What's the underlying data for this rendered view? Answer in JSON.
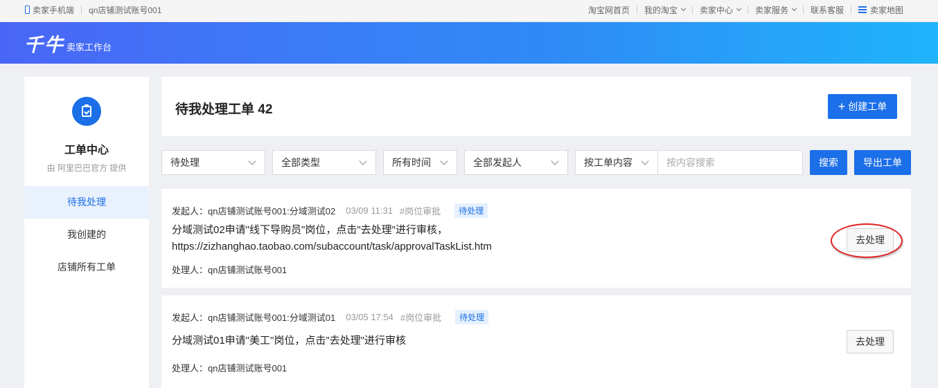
{
  "topbar": {
    "left": {
      "mobile": "卖家手机端",
      "account": "qn店铺测试账号001"
    },
    "right": [
      {
        "label": "淘宝网首页",
        "dropdown": false
      },
      {
        "label": "我的淘宝",
        "dropdown": true
      },
      {
        "label": "卖家中心",
        "dropdown": true
      },
      {
        "label": "卖家服务",
        "dropdown": true
      },
      {
        "label": "联系客服",
        "dropdown": false
      },
      {
        "label": "卖家地图",
        "icon": "menu-icon"
      }
    ]
  },
  "banner": {
    "logo": "千牛",
    "subtitle": "卖家工作台"
  },
  "sidebar": {
    "icon": "clipboard-check-icon",
    "title": "工单中心",
    "subtitle": "由 阿里巴巴官方 提供",
    "items": [
      {
        "label": "待我处理",
        "active": true
      },
      {
        "label": "我创建的",
        "active": false
      },
      {
        "label": "店铺所有工单",
        "active": false
      }
    ]
  },
  "header": {
    "title": "待我处理工单 42",
    "create_label": "创建工单"
  },
  "filters": {
    "status": "待处理",
    "type": "全部类型",
    "time": "所有时间",
    "initiator": "全部发起人",
    "search_mode": "按工单内容",
    "search_placeholder": "按内容搜索",
    "search_label": "搜索",
    "export_label": "导出工单"
  },
  "tasks": [
    {
      "initiator": "发起人：qn店铺测试账号001:分域测试02",
      "time": "03/09 11:31",
      "tag": "#岗位审批",
      "status": "待处理",
      "content_line1": "分域测试02申请\"线下导购员\"岗位，点击\"去处理\"进行审核，",
      "content_line2": "https://zizhanghao.taobao.com/subaccount/task/approvalTaskList.htm",
      "handler": "处理人：qn店铺测试账号001",
      "action": "去处理"
    },
    {
      "initiator": "发起人：qn店铺测试账号001:分域测试01",
      "time": "03/05 17:54",
      "tag": "#岗位审批",
      "status": "待处理",
      "content_line1": "分域测试01申请\"美工\"岗位，点击\"去处理\"进行审核",
      "handler": "处理人：qn店铺测试账号001",
      "action": "去处理"
    }
  ],
  "colors": {
    "accent": "#1b6fe8",
    "highlight_ring": "#e02020"
  }
}
